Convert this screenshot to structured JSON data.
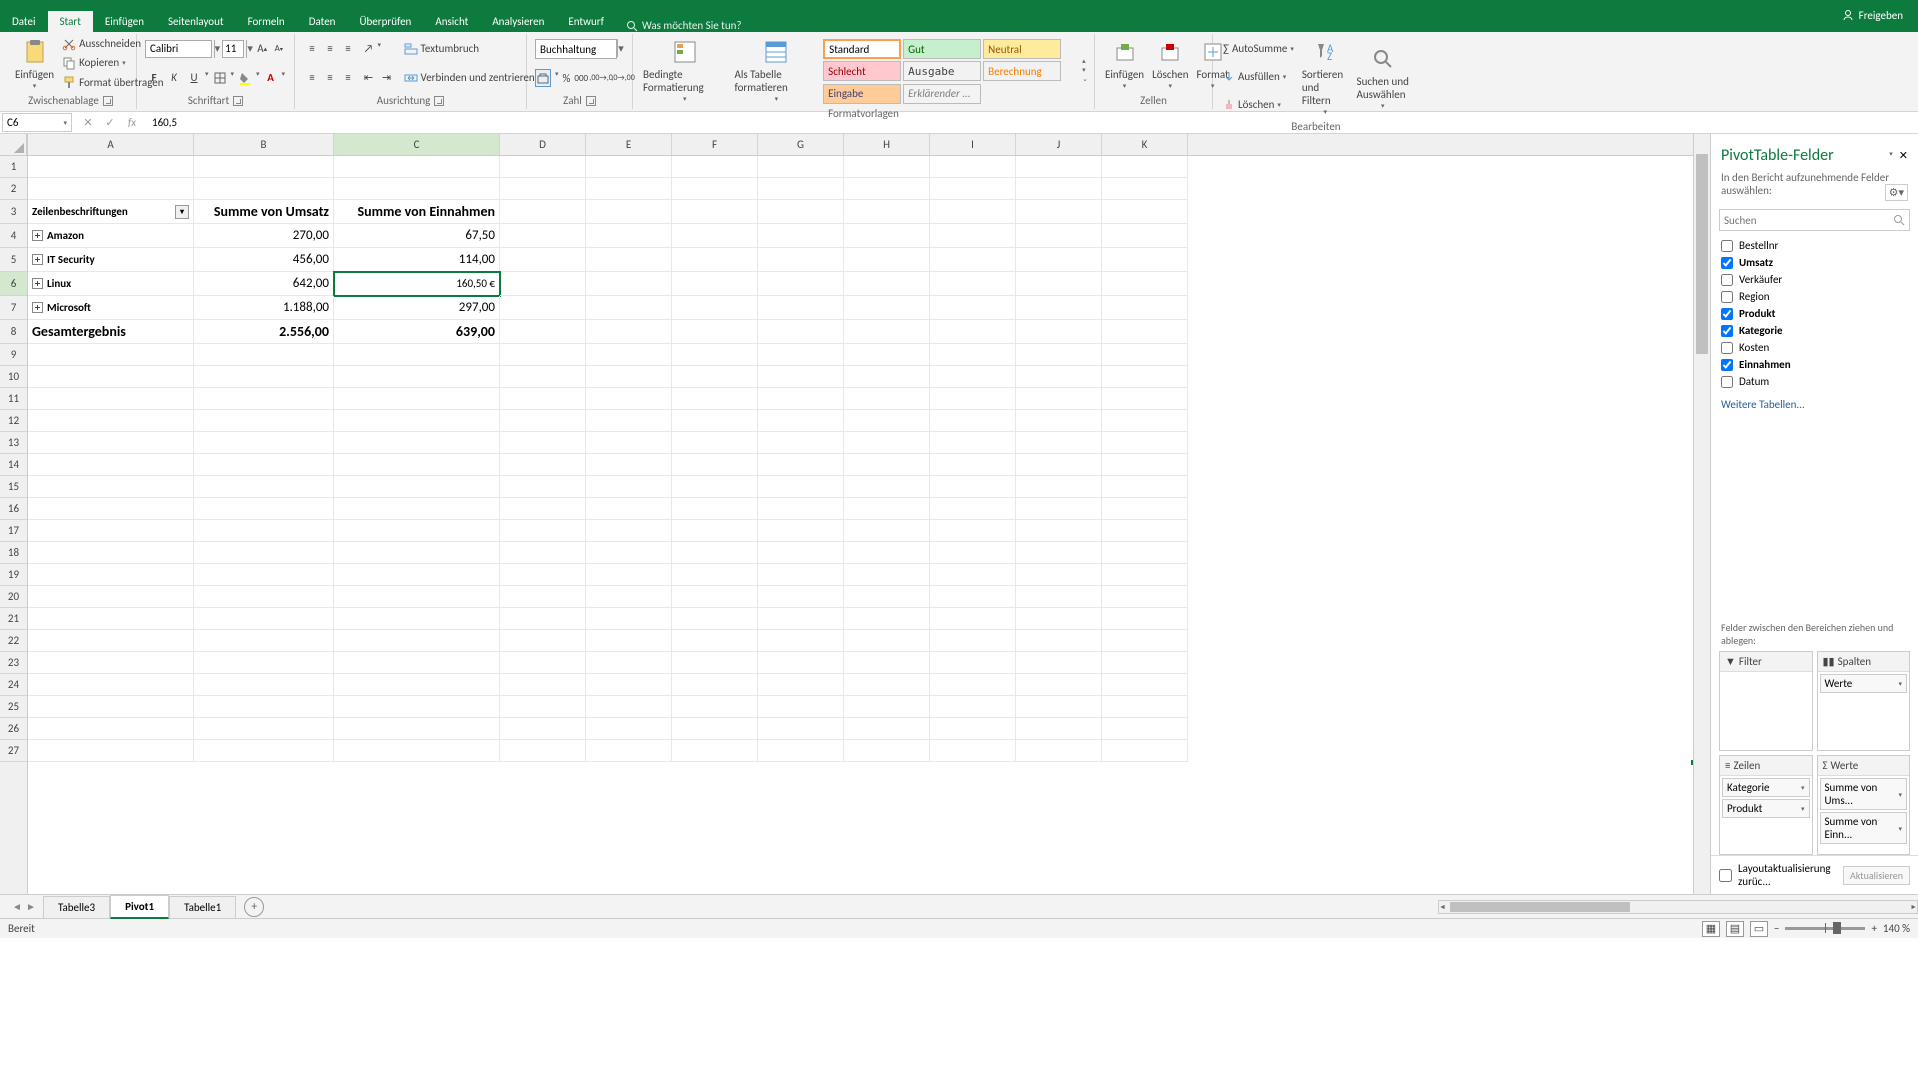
{
  "tabs": [
    "Datei",
    "Start",
    "Einfügen",
    "Seitenlayout",
    "Formeln",
    "Daten",
    "Überprüfen",
    "Ansicht",
    "Analysieren",
    "Entwurf"
  ],
  "active_tab": "Start",
  "tell_me": "Was möchten Sie tun?",
  "share": "Freigeben",
  "ribbon": {
    "clipboard": {
      "paste": "Einfügen",
      "cut": "Ausschneiden",
      "copy": "Kopieren",
      "format": "Format übertragen",
      "label": "Zwischenablage"
    },
    "font": {
      "name": "Calibri",
      "size": "11",
      "label": "Schriftart"
    },
    "align": {
      "wrap": "Textumbruch",
      "merge": "Verbinden und zentrieren",
      "label": "Ausrichtung"
    },
    "number": {
      "format": "Buchhaltung",
      "label": "Zahl"
    },
    "styles": {
      "cond": "Bedingte Formatierung",
      "table": "Als Tabelle formatieren",
      "standard": "Standard",
      "gut": "Gut",
      "neutral": "Neutral",
      "schlecht": "Schlecht",
      "ausgabe": "Ausgabe",
      "berechnung": "Berechnung",
      "eingabe": "Eingabe",
      "erkl": "Erklärender ...",
      "label": "Formatvorlagen"
    },
    "cells": {
      "insert": "Einfügen",
      "delete": "Löschen",
      "format": "Format",
      "label": "Zellen"
    },
    "editing": {
      "sum": "AutoSumme",
      "fill": "Ausfüllen",
      "clear": "Löschen",
      "sort": "Sortieren und Filtern",
      "find": "Suchen und Auswählen",
      "label": "Bearbeiten"
    }
  },
  "namebox": "C6",
  "formula": "160,5",
  "columns": [
    "A",
    "B",
    "C",
    "D",
    "E",
    "F",
    "G",
    "H",
    "I",
    "J",
    "K"
  ],
  "rows_nums": [
    "1",
    "2",
    "3",
    "4",
    "5",
    "6",
    "7",
    "8",
    "9",
    "10",
    "11",
    "12",
    "13",
    "14",
    "15",
    "16",
    "17",
    "18",
    "19",
    "20",
    "21",
    "22",
    "23",
    "24",
    "25",
    "26",
    "27"
  ],
  "pivot": {
    "headers": {
      "a": "Zeilenbeschriftungen",
      "b": "Summe von Umsatz",
      "c": "Summe von Einnahmen"
    },
    "rows": [
      {
        "a": "Amazon",
        "b": "270,00",
        "c": "67,50"
      },
      {
        "a": "IT Security",
        "b": "456,00",
        "c": "114,00"
      },
      {
        "a": "Linux",
        "b": "642,00",
        "c": "160,50 €"
      },
      {
        "a": "Microsoft",
        "b": "1.188,00",
        "c": "297,00"
      }
    ],
    "total": {
      "a": "Gesamtergebnis",
      "b": "2.556,00",
      "c": "639,00"
    }
  },
  "pivot_pane": {
    "title": "PivotTable-Felder",
    "sub": "In den Bericht aufzunehmende Felder auswählen:",
    "search": "Suchen",
    "fields": [
      {
        "name": "Bestellnr",
        "checked": false
      },
      {
        "name": "Umsatz",
        "checked": true
      },
      {
        "name": "Verkäufer",
        "checked": false
      },
      {
        "name": "Region",
        "checked": false
      },
      {
        "name": "Produkt",
        "checked": true
      },
      {
        "name": "Kategorie",
        "checked": true
      },
      {
        "name": "Kosten",
        "checked": false
      },
      {
        "name": "Einnahmen",
        "checked": true
      },
      {
        "name": "Datum",
        "checked": false
      }
    ],
    "more": "Weitere Tabellen...",
    "areas_label": "Felder zwischen den Bereichen ziehen und ablegen:",
    "filter": "Filter",
    "cols": "Spalten",
    "rows": "Zeilen",
    "values": "Werte",
    "cols_items": [
      "Werte"
    ],
    "rows_items": [
      "Kategorie",
      "Produkt"
    ],
    "values_items": [
      "Summe von Ums...",
      "Summe von Einn..."
    ],
    "defer": "Layoutaktualisierung zurüc...",
    "update": "Aktualisieren"
  },
  "sheets": [
    "Tabelle3",
    "Pivot1",
    "Tabelle1"
  ],
  "active_sheet": "Pivot1",
  "status": "Bereit",
  "zoom": "140 %"
}
